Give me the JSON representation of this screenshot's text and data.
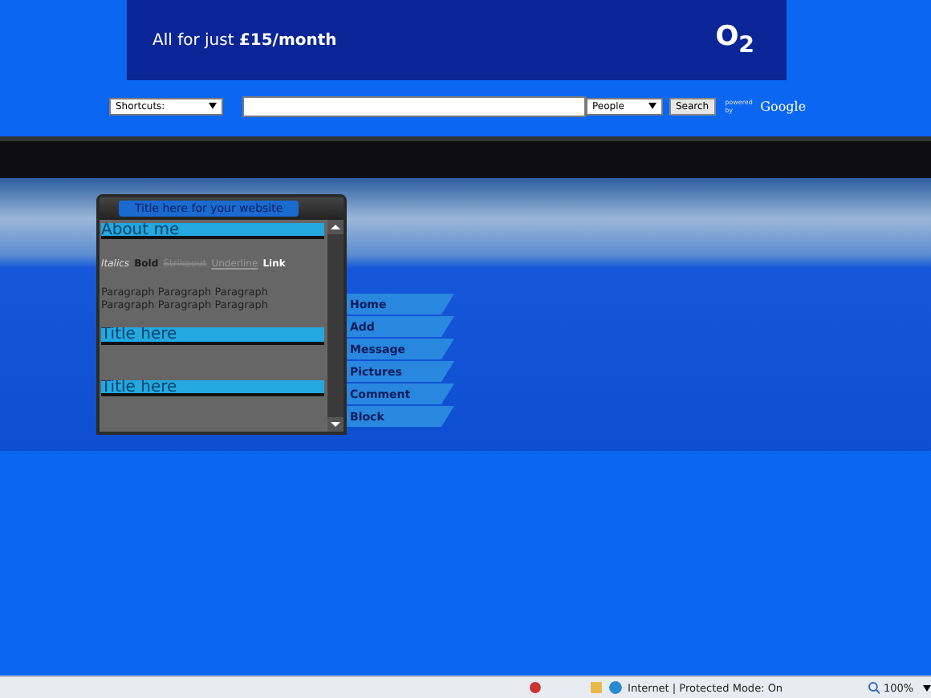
{
  "banner": {
    "text": "All for just **£15/month**",
    "logo": "O$_{2}$"
  },
  "search_bar": {
    "shortcuts": "Shortcuts:",
    "scope": "People",
    "button": "Search",
    "powered": "powered by",
    "brand": "Google"
  },
  "profile_box": {
    "title": "Title here for your website",
    "sections": [
      {
        "heading": "About me",
        "styles": [
          {
            "label": "Italics",
            "kind": "italic"
          },
          {
            "label": "Bold",
            "kind": "bold"
          },
          {
            "label": "Strikeout",
            "kind": "strike"
          },
          {
            "label": "Underline",
            "kind": "underline"
          },
          {
            "label": "Link",
            "kind": "link"
          }
        ],
        "paragraph": "Paragraph Paragraph Paragraph Paragraph Paragraph Paragraph"
      },
      {
        "heading": "Title here"
      },
      {
        "heading": "Title here"
      }
    ]
  },
  "nav": [
    "Home",
    "Add",
    "Message",
    "Pictures",
    "Comment",
    "Block"
  ],
  "status_bar": {
    "zone": "Internet | Protected Mode: On",
    "zoom": "100%"
  }
}
